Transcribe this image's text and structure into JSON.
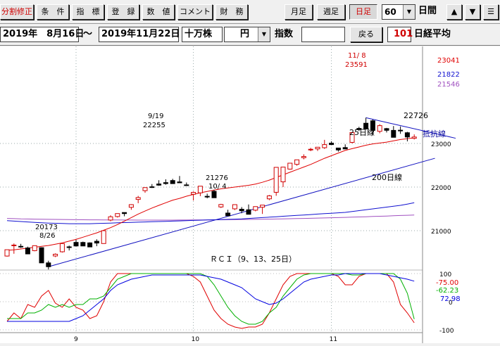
{
  "toolbar": {
    "buttons": [
      "分割修正",
      "条　件",
      "指　標",
      "登　録",
      "数　値",
      "コメント",
      "財　務"
    ],
    "period_buttons": [
      "月足",
      "週足",
      "日足"
    ],
    "count_value": "60",
    "count_unit": "日間",
    "nav": [
      "▲",
      "▼",
      "☰"
    ]
  },
  "range": {
    "start": "2019年　8月16日",
    "sep": "～",
    "end": "2019年11月22日",
    "unit_label": "十万株",
    "currency": "円",
    "index_label": "指数",
    "back_label": "戻る",
    "code": "101",
    "name": "日経平均"
  },
  "colors": {
    "ma25": "#e00000",
    "ma75": "#1010d0",
    "ma200": "#a050c0",
    "rci9": "#e00000",
    "rci13": "#00b000",
    "rci25": "#0000e0",
    "trend": "#1010c0"
  },
  "chart_data": [
    {
      "type": "candlestick",
      "title": "",
      "xlabel": "",
      "ylabel": "",
      "ylim": [
        20000,
        23650
      ],
      "grid": true,
      "x_ticks": [
        "9",
        "10",
        "11"
      ],
      "y_ticks": [
        "23000",
        "22000",
        "21000"
      ],
      "candles": [
        [
          20418,
          20563,
          20405,
          20563
        ],
        [
          20669,
          20706,
          20471,
          20670
        ],
        [
          20641,
          20698,
          20605,
          20628
        ],
        [
          20604,
          20634,
          20459,
          20467
        ],
        [
          20541,
          20660,
          20528,
          20656
        ],
        [
          20610,
          20618,
          20260,
          20261
        ],
        [
          20261,
          20310,
          20110,
          20173
        ],
        [
          20420,
          20479,
          20394,
          20460
        ],
        [
          20516,
          20711,
          20498,
          20704
        ],
        [
          20629,
          20658,
          20546,
          20620
        ],
        [
          20731,
          20791,
          20638,
          20649
        ],
        [
          20730,
          20749,
          20666,
          20649
        ],
        [
          20720,
          20732,
          20630,
          20627
        ],
        [
          20757,
          20802,
          20644,
          20716
        ],
        [
          20705,
          21000,
          20700,
          21000
        ],
        [
          21243,
          21352,
          21216,
          21318
        ],
        [
          21324,
          21359,
          21301,
          21392
        ],
        [
          21416,
          21418,
          21330,
          21392
        ],
        [
          21536,
          21607,
          21479,
          21597
        ],
        [
          21716,
          21797,
          21630,
          21759
        ],
        [
          21918,
          21951,
          21868,
          21988
        ],
        [
          22006,
          22069,
          21980,
          22001
        ],
        [
          22071,
          22157,
          22029,
          22044
        ],
        [
          22102,
          22178,
          22054,
          22080
        ],
        [
          22150,
          22189,
          22078,
          22079
        ],
        [
          22118,
          22255,
          22098,
          22098
        ],
        [
          22050,
          22105,
          22030,
          22048
        ],
        [
          21835,
          21900,
          21692,
          21878
        ],
        [
          21867,
          21898,
          21792,
          22020
        ],
        [
          21788,
          21849,
          21742,
          21778
        ],
        [
          21902,
          21933,
          21818,
          21755
        ],
        [
          21544,
          21615,
          21520,
          21600
        ],
        [
          21404,
          21480,
          21341,
          21341
        ],
        [
          21501,
          21600,
          21473,
          21597
        ],
        [
          21492,
          21541,
          21400,
          21456
        ],
        [
          21479,
          21600,
          21450,
          21376
        ],
        [
          21470,
          21520,
          21444,
          21552
        ],
        [
          21538,
          21590,
          21384,
          21586
        ],
        [
          21730,
          21818,
          21700,
          21798
        ],
        [
          21880,
          21904,
          21800,
          22452
        ],
        [
          22120,
          22225,
          22000,
          22458
        ],
        [
          22412,
          22504,
          22400,
          22548
        ],
        [
          22521,
          22594,
          22490,
          22625
        ],
        [
          22674,
          22751,
          22636,
          22700
        ],
        [
          22860,
          22899,
          22823,
          22867
        ],
        [
          22876,
          22905,
          22829,
          22914
        ],
        [
          22903,
          23083,
          22875,
          22974
        ],
        [
          23008,
          23051,
          23000,
          22974
        ],
        [
          22896,
          22900,
          22813,
          22851
        ],
        [
          22906,
          22980,
          22890,
          22874
        ],
        [
          23025,
          23256,
          23003,
          23251
        ],
        [
          23345,
          23382,
          23282,
          23319
        ],
        [
          23464,
          23591,
          23448,
          23331
        ],
        [
          23520,
          23550,
          23200,
          23300
        ],
        [
          23278,
          23441,
          23234,
          23409
        ],
        [
          23341,
          23356,
          23253,
          23302
        ],
        [
          23300,
          23400,
          23150,
          23141
        ],
        [
          23304,
          23391,
          23221,
          23303
        ],
        [
          23246,
          23266,
          23048,
          23148
        ],
        [
          23118,
          23208,
          23092,
          23148
        ]
      ],
      "ma25": [
        20550,
        20560,
        20580,
        20600,
        20620,
        20640,
        20660,
        20690,
        20720,
        20760,
        20800,
        20850,
        20900,
        20950,
        21010,
        21070,
        21140,
        21220,
        21300,
        21380,
        21450,
        21520,
        21580,
        21640,
        21700,
        21740,
        21790,
        21830,
        21870,
        21900,
        21930,
        21960,
        21980,
        22000,
        22020,
        22040,
        22070,
        22110,
        22160,
        22220,
        22280,
        22340,
        22400,
        22460,
        22520,
        22590,
        22660,
        22720,
        22780,
        22840,
        22880,
        22920,
        22960,
        22990,
        23010,
        23030,
        23060,
        23090,
        23110,
        23130
      ],
      "ma75": [
        21230,
        21220,
        21210,
        21200,
        21190,
        21180,
        21175,
        21170,
        21165,
        21160,
        21160,
        21160,
        21160,
        21165,
        21170,
        21175,
        21180,
        21185,
        21190,
        21195,
        21200,
        21205,
        21210,
        21215,
        21220,
        21225,
        21230,
        21235,
        21240,
        21245,
        21250,
        21255,
        21260,
        21265,
        21270,
        21280,
        21290,
        21300,
        21310,
        21320,
        21330,
        21340,
        21350,
        21360,
        21370,
        21380,
        21390,
        21400,
        21410,
        21420,
        21440,
        21460,
        21480,
        21500,
        21520,
        21540,
        21560,
        21580,
        21610,
        21640
      ],
      "ma200": [
        21280,
        21275,
        21270,
        21268,
        21265,
        21262,
        21260,
        21258,
        21256,
        21254,
        21252,
        21250,
        21249,
        21248,
        21247,
        21246,
        21245,
        21244,
        21243,
        21242,
        21242,
        21242,
        21242,
        21242,
        21242,
        21243,
        21244,
        21245,
        21246,
        21247,
        21248,
        21250,
        21252,
        21254,
        21256,
        21258,
        21260,
        21262,
        21265,
        21268,
        21271,
        21274,
        21277,
        21280,
        21284,
        21288,
        21292,
        21296,
        21300,
        21305,
        21310,
        21315,
        21320,
        21325,
        21330,
        21336,
        21342,
        21348,
        21354,
        21360
      ],
      "trendline": [
        [
          6,
          20173
        ],
        [
          62,
          22660
        ]
      ],
      "last_values": {
        "ma25": "23041",
        "ma75": "21822",
        "ma200": "21546"
      },
      "annotations": [
        {
          "label": "11/ 8",
          "value": "23591",
          "index": 52
        },
        {
          "label": "9/19",
          "value": "22255",
          "index": 25
        },
        {
          "label": "21276",
          "value": "10/ 4",
          "index": 35
        },
        {
          "label": "20173",
          "value": "8/26",
          "index": 6
        },
        {
          "label": "22726",
          "index": 58
        },
        {
          "label": "25日線",
          "index": 52
        },
        {
          "label": "抵抗線",
          "index": 60
        },
        {
          "label": "200日線",
          "index": 56
        }
      ]
    },
    {
      "type": "line",
      "title": "ＲＣＩ（9、13、25日）",
      "ylim": [
        -100,
        100
      ],
      "y_ticks": [
        "100",
        "0",
        "-100"
      ],
      "series": [
        {
          "name": "9",
          "last": "-75.00",
          "values": [
            -70,
            -40,
            -60,
            -10,
            -20,
            20,
            40,
            -5,
            -20,
            10,
            -20,
            -30,
            -60,
            -50,
            0,
            70,
            100,
            100,
            100,
            100,
            100,
            100,
            100,
            100,
            100,
            100,
            100,
            90,
            70,
            20,
            -30,
            -60,
            -80,
            -90,
            -95,
            -90,
            -90,
            -80,
            -40,
            10,
            60,
            90,
            100,
            100,
            100,
            100,
            100,
            100,
            90,
            60,
            60,
            90,
            100,
            100,
            100,
            100,
            70,
            -10,
            -40,
            -75
          ]
        },
        {
          "name": "13",
          "last": "-62.23",
          "values": [
            -60,
            -60,
            -60,
            -40,
            -40,
            -30,
            -10,
            -20,
            -10,
            -20,
            -10,
            -10,
            10,
            10,
            20,
            50,
            80,
            90,
            100,
            100,
            100,
            100,
            100,
            100,
            100,
            100,
            100,
            100,
            100,
            90,
            60,
            20,
            -20,
            -50,
            -70,
            -80,
            -80,
            -70,
            -40,
            -20,
            20,
            50,
            80,
            95,
            100,
            100,
            100,
            100,
            100,
            100,
            95,
            95,
            100,
            100,
            100,
            100,
            100,
            80,
            30,
            -62
          ]
        },
        {
          "name": "25",
          "last": "72.98",
          "values": [
            -70,
            -70,
            -70,
            -70,
            -70,
            -70,
            -70,
            -70,
            -70,
            -70,
            -60,
            -50,
            -30,
            -10,
            10,
            40,
            60,
            70,
            80,
            85,
            90,
            95,
            95,
            95,
            95,
            95,
            95,
            95,
            95,
            90,
            85,
            80,
            70,
            60,
            50,
            30,
            10,
            0,
            -10,
            -5,
            10,
            30,
            50,
            70,
            80,
            85,
            90,
            95,
            95,
            100,
            100,
            100,
            100,
            100,
            100,
            95,
            90,
            85,
            80,
            73
          ]
        }
      ],
      "x_ticks": [
        "9",
        "10",
        "11"
      ]
    }
  ]
}
